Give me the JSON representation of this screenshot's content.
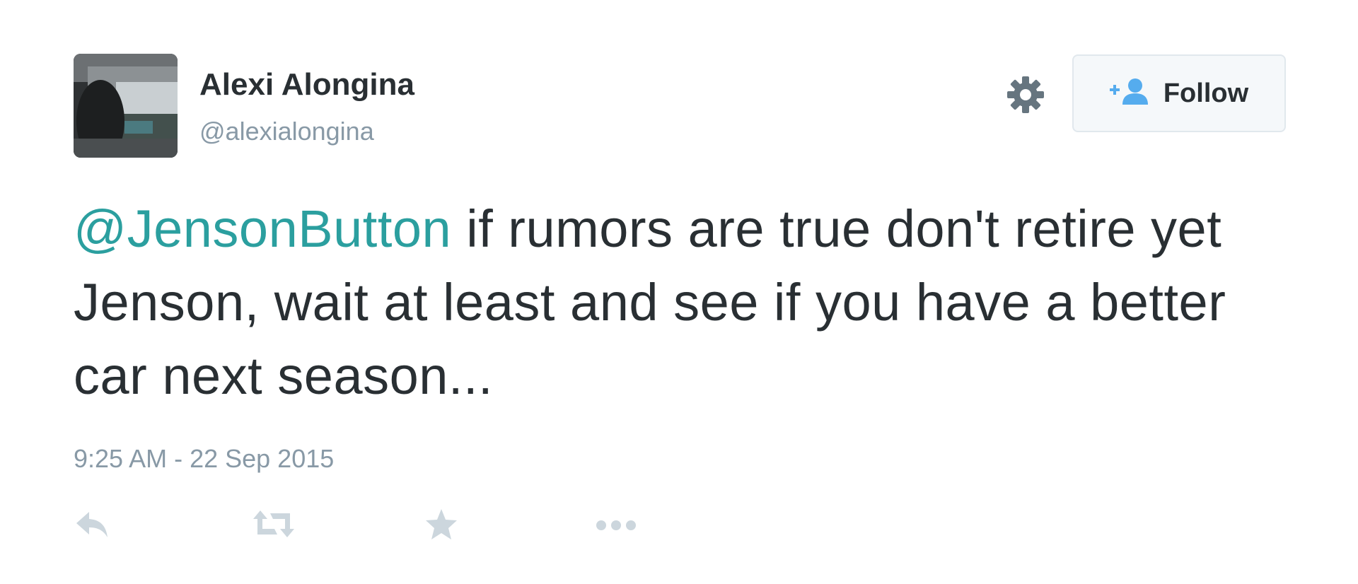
{
  "user": {
    "full_name": "Alexi Alongina",
    "screen_name": "@alexialongina"
  },
  "header": {
    "settings_icon": "gear-icon",
    "follow_label": "Follow",
    "follow_icon": "add-user-icon"
  },
  "tweet": {
    "mention": "@JensonButton",
    "text": " if rumors are true don't retire yet Jenson, wait at least and see if you have a better car next season...",
    "timestamp": "9:25 AM - 22 Sep 2015"
  },
  "actions": [
    {
      "name": "reply",
      "icon": "reply-icon"
    },
    {
      "name": "retweet",
      "icon": "retweet-icon"
    },
    {
      "name": "favorite",
      "icon": "star-icon"
    },
    {
      "name": "more",
      "icon": "more-icon"
    }
  ],
  "colors": {
    "text": "#292f33",
    "muted": "#8899a6",
    "mention": "#2b9f9f",
    "icon": "#ccd6dd",
    "follow_icon": "#55acee",
    "gear": "#66757f"
  }
}
